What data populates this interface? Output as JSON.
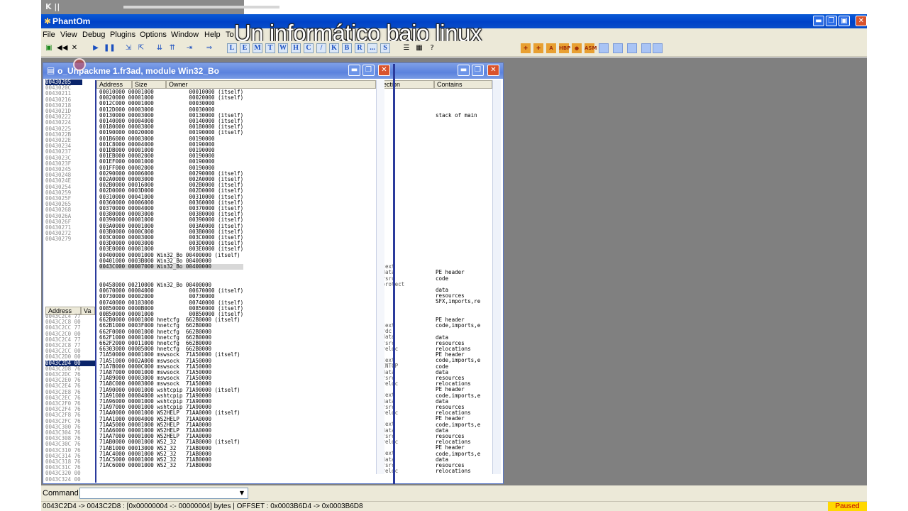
{
  "player": {
    "pause_glyph": "K ||"
  },
  "app": {
    "title": "PhantOm",
    "icon": "bug-icon"
  },
  "overlay": {
    "text": "Un informático bajo linux"
  },
  "menu": [
    "File",
    "View",
    "Debug",
    "Plugins",
    "Options",
    "Window",
    "Help",
    "To"
  ],
  "toolbar": {
    "letters": [
      "L",
      "E",
      "M",
      "T",
      "W",
      "H",
      "C",
      "/",
      "K",
      "B",
      "R",
      "...",
      "S"
    ],
    "plugins": [
      "HBP",
      "ASM"
    ]
  },
  "child": {
    "title": "o_Unpackme 1.fr3ad, module Win32_Bo"
  },
  "columns": {
    "address": "Address",
    "size": "Size",
    "owner": "Owner",
    "section": "Section",
    "contains": "Contains",
    "dump_address": "Address",
    "dump_value": "Va"
  },
  "addr_list": [
    "00430205",
    "0043020C",
    "00430211",
    "00430216",
    "00430218",
    "0043021D",
    "00430222",
    "00430224",
    "00430225",
    "0043022B",
    "0043022E",
    "00430234",
    "00430237",
    "0043023C",
    "0043023F",
    "00430245",
    "00430248",
    "0043024E",
    "00430254",
    "00430259",
    "0043025F",
    "00430265",
    "00430268",
    "0043026A",
    "0043026F",
    "00430271",
    "00430272",
    "00430279"
  ],
  "memory_map": [
    "00010000 00001000           00010000 (itself)",
    "00020000 00001000           00020000 (itself)",
    "0012C000 00001000           00030000",
    "0012D000 00003000           00030000",
    "00130000 00003000           00130000 (itself)",
    "00140000 00004000           00140000 (itself)",
    "00180000 00003000           00180000 (itself)",
    "00190000 00020000           00190000 (itself)",
    "001B6000 00003000           00190000",
    "001C8000 00004000           00190000",
    "001DB000 00001000           00190000",
    "001EB000 00002000           00190000",
    "001EF000 00001000           00190000",
    "001FF000 00002000           00190000",
    "00290000 00006000           00290000 (itself)",
    "002A0000 00003000           002A0000 (itself)",
    "002B0000 00016000           002B0000 (itself)",
    "002D0000 0003D000           002D0000 (itself)",
    "00310000 00041000           00310000 (itself)",
    "00360000 00006000           00360000 (itself)",
    "00370000 00004000           00370000 (itself)",
    "00380000 00003000           00380000 (itself)",
    "00390000 00001000           00390000 (itself)",
    "003A0000 00001000           003A0000 (itself)",
    "003B0000 0000C000           003B0000 (itself)",
    "003C0000 00003000           003C0000 (itself)",
    "003D0000 00003000           003D0000 (itself)",
    "003E0000 00001000           003E0000 (itself)",
    "00400000 00001000 Win32_Bo 00400000 (itself)",
    "00401000 0003B000 Win32_Bo 00400000",
    "0043C000 00007000 Win32_Bo 00400000"
  ],
  "memory_map_2": [
    "00458000 00210000 Win32_Bo 00400000",
    "00670000 00004000           00670000 (itself)",
    "00730000 00002000           00730000",
    "00740000 00103000           00740000 (itself)",
    "00850000 0000B000           00850000 (itself)",
    "00B50000 00001000           00B50000 (itself)",
    "662B0000 00001000 hnetcfg  662B0000 (itself)",
    "662B1000 0003F000 hnetcfg  662B0000",
    "662F0000 00001000 hnetcfg  662B0000",
    "662F1000 00001000 hnetcfg  662B0000",
    "662F2000 00011000 hnetcfg  662B0000",
    "66303000 00005000 hnetcfg  662B0000",
    "71A50000 00001000 mswsock  71A50000 (itself)",
    "71A51000 0002A000 mswsock  71A50000",
    "71A7B000 0000C000 mswsock  71A50000",
    "71A87000 00001000 mswsock  71A50000",
    "71A89000 00003000 mswsock  71A50000",
    "71A8C000 00003000 mswsock  71A50000",
    "71A90000 00001000 wshtcpip 71A90000 (itself)",
    "71A91000 00004000 wshtcpip 71A90000",
    "71A96000 00001000 wshtcpip 71A90000",
    "71A97000 00001000 wshtcpip 71A90000",
    "71AA0000 00001000 WS2HELP  71AA0000 (itself)",
    "71AA1000 00004000 WS2HELP  71AA0000",
    "71AA5000 00001000 WS2HELP  71AA0000",
    "71AA6000 00001000 WS2HELP  71AA0000",
    "71AA7000 00001000 WS2HELP  71AA0000",
    "71AB0000 00001000 WS2_32   71AB0000 (itself)",
    "71AB1000 00013000 WS2_32   71AB0000",
    "71AC4000 00001000 WS2_32   71AB0000",
    "71AC5000 00001000 WS2_32   71AB0000",
    "71AC6000 00001000 WS2_32   71AB0000"
  ],
  "contains_top": "\n\n\n\nstack of main\n\n\n\n\n\n\n\n\n\n\n\n\n\n\n\n\n\n\n\n\n\n\n\n\n\n\nPE header\ncode\n\ndata\nresources\nSFX,imports,re",
  "section_top": "\n\n\n\n\n\n\n\n\n\n\n\n\n\n\n\n\n\n\n\n\n\n\n\n\n\n\n\n\n\n.text\n.data\n.rsrc\n.protect",
  "contains_bottom": "PE header\ncode,imports,e\n\ndata\nresources\nrelocations\nPE header\ncode,imports,e\ncode\ndata\nresources\nrelocations\nPE header\ncode,imports,e\ndata\nresources\nrelocations\nPE header\ncode,imports,e\ndata\nresources\nrelocations\nPE header\ncode,imports,e\ndata\nresources\nrelocations",
  "section_bottom": ".text\n.rdc\n.data\n.rsrc\n.reloc\n\n.text\nKCNTCP\n.data\n.rsrc\n.reloc\n\n.text\n.data\n.rsrc\n.reloc\n\n.text\n.data\n.rsrc\n.reloc\n\n.text\n.data\n.rsrc\n.reloc",
  "dump_list": [
    "0043C2C4 77",
    "0043C2C8 00",
    "0043C2CC 77",
    "0043C2C0 00",
    "0043C2C4 77",
    "0043C2C8 77",
    "0043C2CC 00",
    "0043C2D0 00",
    "0043C2D4 00",
    "0043C2D8 76",
    "0043C2DC 76",
    "0043C2E0 76",
    "0043C2E4 76",
    "0043C2E8 76",
    "0043C2EC 76",
    "0043C2F0 76",
    "0043C2F4 76",
    "0043C2F8 76",
    "0043C2FC 76",
    "0043C300 76",
    "0043C304 76",
    "0043C308 76",
    "0043C30C 76",
    "0043C310 76",
    "0043C314 76",
    "0043C318 76",
    "0043C31C 76",
    "0043C320 00",
    "0043C324 00",
    "0043C328 00"
  ],
  "command": {
    "label": "Command",
    "value": ""
  },
  "status": {
    "text": "0043C2D4 -> 0043C2D8 : [0x00000004 -:- 00000004] bytes  |  OFFSET : 0x0003B6D4 -> 0x0003B6D8",
    "state": "Paused"
  }
}
